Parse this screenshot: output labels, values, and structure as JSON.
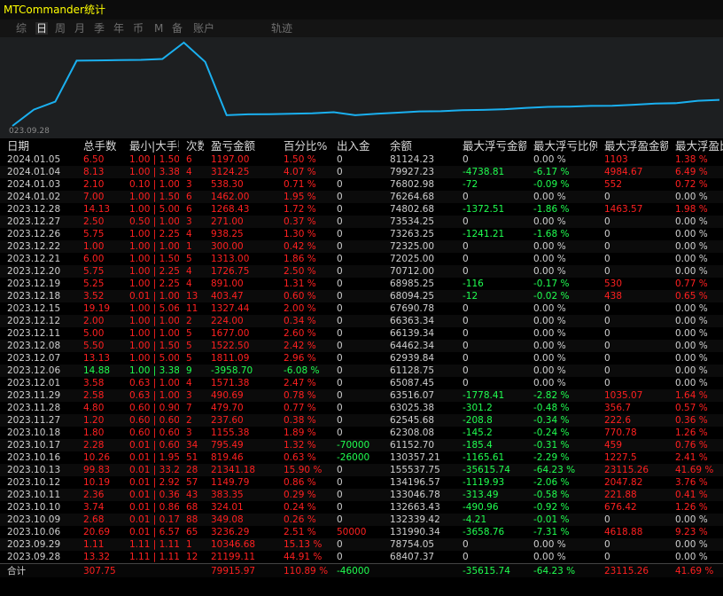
{
  "window": {
    "title": "MTCommander统计"
  },
  "tabs": [
    {
      "label": "综"
    },
    {
      "label": "日",
      "active": true
    },
    {
      "label": "周"
    },
    {
      "label": "月"
    },
    {
      "label": "季"
    },
    {
      "label": "年"
    },
    {
      "label": "币"
    },
    {
      "label": "M"
    },
    {
      "label": "备"
    },
    {
      "label": "账户"
    },
    {
      "label": "轨迹"
    }
  ],
  "chart": {
    "start_label": "023.09.28",
    "line_color": "#1ab0f0"
  },
  "table": {
    "headers": [
      "日期",
      "总手数",
      "最小|大手数",
      "次数",
      "盈亏金额",
      "百分比%",
      "出入金",
      "余额",
      "最大浮亏金额",
      "最大浮亏比例",
      "最大浮盈金额",
      "最大浮盈比"
    ],
    "rows": [
      [
        "2024.01.05",
        "6.50",
        "1.00 | 1.50",
        "6",
        "1197.00",
        "1.50 %",
        "0",
        "81124.23",
        "0",
        "0.00 %",
        "1103",
        "1.38 %"
      ],
      [
        "2024.01.04",
        "8.13",
        "1.00 | 3.38",
        "4",
        "3124.25",
        "4.07 %",
        "0",
        "79927.23",
        "-4738.81",
        "-6.17 %",
        "4984.67",
        "6.49 %"
      ],
      [
        "2024.01.03",
        "2.10",
        "0.10 | 1.00",
        "3",
        "538.30",
        "0.71 %",
        "0",
        "76802.98",
        "-72",
        "-0.09 %",
        "552",
        "0.72 %"
      ],
      [
        "2024.01.02",
        "7.00",
        "1.00 | 1.50",
        "6",
        "1462.00",
        "1.95 %",
        "0",
        "76264.68",
        "0",
        "0.00 %",
        "0",
        "0.00 %"
      ],
      [
        "2023.12.28",
        "14.13",
        "1.00 | 5.00",
        "6",
        "1268.43",
        "1.72 %",
        "0",
        "74802.68",
        "-1372.51",
        "-1.86 %",
        "1463.57",
        "1.98 %"
      ],
      [
        "2023.12.27",
        "2.50",
        "0.50 | 1.00",
        "3",
        "271.00",
        "0.37 %",
        "0",
        "73534.25",
        "0",
        "0.00 %",
        "0",
        "0.00 %"
      ],
      [
        "2023.12.26",
        "5.75",
        "1.00 | 2.25",
        "4",
        "938.25",
        "1.30 %",
        "0",
        "73263.25",
        "-1241.21",
        "-1.68 %",
        "0",
        "0.00 %"
      ],
      [
        "2023.12.22",
        "1.00",
        "1.00 | 1.00",
        "1",
        "300.00",
        "0.42 %",
        "0",
        "72325.00",
        "0",
        "0.00 %",
        "0",
        "0.00 %"
      ],
      [
        "2023.12.21",
        "6.00",
        "1.00 | 1.50",
        "5",
        "1313.00",
        "1.86 %",
        "0",
        "72025.00",
        "0",
        "0.00 %",
        "0",
        "0.00 %"
      ],
      [
        "2023.12.20",
        "5.75",
        "1.00 | 2.25",
        "4",
        "1726.75",
        "2.50 %",
        "0",
        "70712.00",
        "0",
        "0.00 %",
        "0",
        "0.00 %"
      ],
      [
        "2023.12.19",
        "5.25",
        "1.00 | 2.25",
        "4",
        "891.00",
        "1.31 %",
        "0",
        "68985.25",
        "-116",
        "-0.17 %",
        "530",
        "0.77 %"
      ],
      [
        "2023.12.18",
        "3.52",
        "0.01 | 1.00",
        "13",
        "403.47",
        "0.60 %",
        "0",
        "68094.25",
        "-12",
        "-0.02 %",
        "438",
        "0.65 %"
      ],
      [
        "2023.12.15",
        "19.19",
        "1.00 | 5.06",
        "11",
        "1327.44",
        "2.00 %",
        "0",
        "67690.78",
        "0",
        "0.00 %",
        "0",
        "0.00 %"
      ],
      [
        "2023.12.12",
        "2.00",
        "1.00 | 1.00",
        "2",
        "224.00",
        "0.34 %",
        "0",
        "66363.34",
        "0",
        "0.00 %",
        "0",
        "0.00 %"
      ],
      [
        "2023.12.11",
        "5.00",
        "1.00 | 1.00",
        "5",
        "1677.00",
        "2.60 %",
        "0",
        "66139.34",
        "0",
        "0.00 %",
        "0",
        "0.00 %"
      ],
      [
        "2023.12.08",
        "5.50",
        "1.00 | 1.50",
        "5",
        "1522.50",
        "2.42 %",
        "0",
        "64462.34",
        "0",
        "0.00 %",
        "0",
        "0.00 %"
      ],
      [
        "2023.12.07",
        "13.13",
        "1.00 | 5.00",
        "5",
        "1811.09",
        "2.96 %",
        "0",
        "62939.84",
        "0",
        "0.00 %",
        "0",
        "0.00 %"
      ],
      [
        "2023.12.06",
        "14.88",
        "1.00 | 3.38",
        "9",
        "-3958.70",
        "-6.08 %",
        "0",
        "61128.75",
        "0",
        "0.00 %",
        "0",
        "0.00 %"
      ],
      [
        "2023.12.01",
        "3.58",
        "0.63 | 1.00",
        "4",
        "1571.38",
        "2.47 %",
        "0",
        "65087.45",
        "0",
        "0.00 %",
        "0",
        "0.00 %"
      ],
      [
        "2023.11.29",
        "2.58",
        "0.63 | 1.00",
        "3",
        "490.69",
        "0.78 %",
        "0",
        "63516.07",
        "-1778.41",
        "-2.82 %",
        "1035.07",
        "1.64 %"
      ],
      [
        "2023.11.28",
        "4.80",
        "0.60 | 0.90",
        "7",
        "479.70",
        "0.77 %",
        "0",
        "63025.38",
        "-301.2",
        "-0.48 %",
        "356.7",
        "0.57 %"
      ],
      [
        "2023.11.27",
        "1.20",
        "0.60 | 0.60",
        "2",
        "237.60",
        "0.38 %",
        "0",
        "62545.68",
        "-208.8",
        "-0.34 %",
        "222.6",
        "0.36 %"
      ],
      [
        "2023.10.18",
        "1.80",
        "0.60 | 0.60",
        "3",
        "1155.38",
        "1.89 %",
        "0",
        "62308.08",
        "-145.2",
        "-0.24 %",
        "770.78",
        "1.26 %"
      ],
      [
        "2023.10.17",
        "2.28",
        "0.01 | 0.60",
        "34",
        "795.49",
        "1.32 %",
        "-70000",
        "61152.70",
        "-185.4",
        "-0.31 %",
        "459",
        "0.76 %"
      ],
      [
        "2023.10.16",
        "10.26",
        "0.01 | 1.95",
        "51",
        "819.46",
        "0.63 %",
        "-26000",
        "130357.21",
        "-1165.61",
        "-2.29 %",
        "1227.5",
        "2.41 %"
      ],
      [
        "2023.10.13",
        "99.83",
        "0.01 | 33.25",
        "28",
        "21341.18",
        "15.90 %",
        "0",
        "155537.75",
        "-35615.74",
        "-64.23 %",
        "23115.26",
        "41.69 %"
      ],
      [
        "2023.10.12",
        "10.19",
        "0.01 | 2.92",
        "57",
        "1149.79",
        "0.86 %",
        "0",
        "134196.57",
        "-1119.93",
        "-2.06 %",
        "2047.82",
        "3.76 %"
      ],
      [
        "2023.10.11",
        "2.36",
        "0.01 | 0.36",
        "43",
        "383.35",
        "0.29 %",
        "0",
        "133046.78",
        "-313.49",
        "-0.58 %",
        "221.88",
        "0.41 %"
      ],
      [
        "2023.10.10",
        "3.74",
        "0.01 | 0.86",
        "68",
        "324.01",
        "0.24 %",
        "0",
        "132663.43",
        "-490.96",
        "-0.92 %",
        "676.42",
        "1.26 %"
      ],
      [
        "2023.10.09",
        "2.68",
        "0.01 | 0.17",
        "88",
        "349.08",
        "0.26 %",
        "0",
        "132339.42",
        "-4.21",
        "-0.01 %",
        "0",
        "0.00 %"
      ],
      [
        "2023.10.06",
        "20.69",
        "0.01 | 6.57",
        "65",
        "3236.29",
        "2.51 %",
        "50000",
        "131990.34",
        "-3658.76",
        "-7.31 %",
        "4618.88",
        "9.23 %"
      ],
      [
        "2023.09.29",
        "1.11",
        "1.11 | 1.11",
        "1",
        "10346.68",
        "15.13 %",
        "0",
        "78754.05",
        "0",
        "0.00 %",
        "0",
        "0.00 %"
      ],
      [
        "2023.09.28",
        "13.32",
        "1.11 | 1.11",
        "12",
        "21199.11",
        "44.91 %",
        "0",
        "68407.37",
        "0",
        "0.00 %",
        "0",
        "0.00 %"
      ]
    ],
    "footer": [
      "合计",
      "307.75",
      "",
      "",
      "79915.97",
      "110.89 %",
      "-46000",
      "",
      "-35615.74",
      "-64.23 %",
      "23115.26",
      "41.69 %"
    ]
  },
  "colors": {
    "positive": "#ff2020",
    "negative": "#20ff50",
    "neutral": "#cfcfcf",
    "title": "#ffff00"
  }
}
